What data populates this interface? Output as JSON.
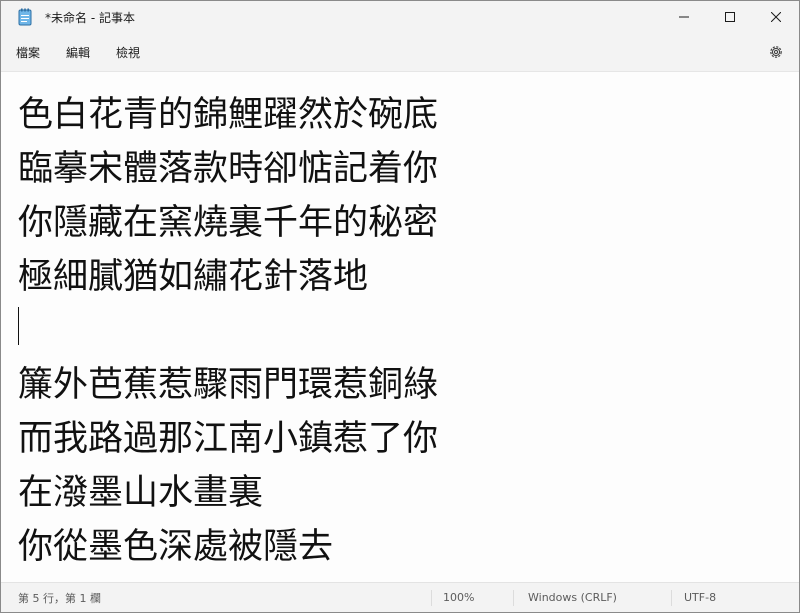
{
  "window": {
    "title": "*未命名 - 記事本"
  },
  "menu": {
    "file": "檔案",
    "edit": "編輯",
    "view": "檢視"
  },
  "editor": {
    "lines": [
      "色白花青的錦鯉躍然於碗底",
      "臨摹宋體落款時卻惦記着你",
      "你隱藏在窯燒裏千年的秘密",
      "極細膩猶如繡花針落地",
      "",
      "簾外芭蕉惹驟雨門環惹銅綠",
      "而我路過那江南小鎮惹了你",
      "在潑墨山水畫裏",
      "你從墨色深處被隱去"
    ]
  },
  "status": {
    "position": "第 5 行，第 1 欄",
    "zoom": "100%",
    "line_ending": "Windows (CRLF)",
    "encoding": "UTF-8"
  },
  "colors": {
    "background": "#fbfbfb",
    "text": "#111111",
    "chrome": "#f3f3f3"
  },
  "icons": [
    "notepad-icon",
    "minimize-icon",
    "maximize-icon",
    "close-icon",
    "gear-icon"
  ]
}
